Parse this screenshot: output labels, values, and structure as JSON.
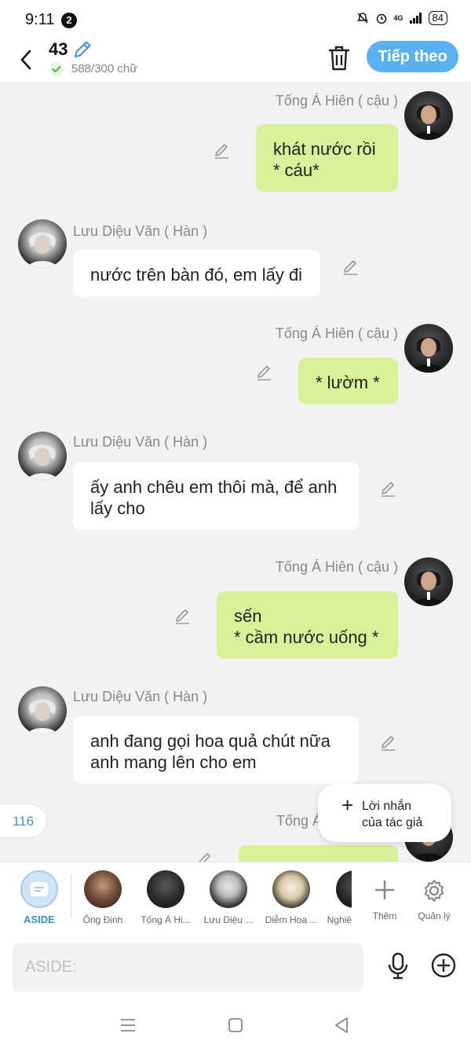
{
  "status_bar": {
    "time": "9:11",
    "notification_count": "2",
    "network": "4G",
    "battery": "84"
  },
  "header": {
    "title_number": "43",
    "word_count": "588/300 chữ",
    "next_label": "Tiếp theo"
  },
  "messages": [
    {
      "side": "right",
      "name": "Tống Á Hiên ( cậu )",
      "text": "khát nước rồi\n* cáu*"
    },
    {
      "side": "left",
      "name": "Lưu Diệu Văn ( Hàn )",
      "text": "nước trên bàn đó, em lấy đi"
    },
    {
      "side": "right",
      "name": "Tống Á Hiên ( cậu )",
      "text": "* lườm *"
    },
    {
      "side": "left",
      "name": "Lưu Diệu Văn ( Hàn )",
      "text": "ấy anh chêu em thôi mà, để anh\nlấy cho"
    },
    {
      "side": "right",
      "name": "Tống Á Hiên ( cậu )",
      "text": "sến\n* cầm nước uống *"
    },
    {
      "side": "left",
      "name": "Lưu Diệu Văn ( Hàn )",
      "text": "anh đang gọi hoa quả chút nữa\nanh mang lên cho em"
    },
    {
      "side": "right",
      "name": "Tống Á",
      "text": ""
    }
  ],
  "counter": "116",
  "author_note": {
    "line1": "Lời nhắn",
    "line2": "của tác giả"
  },
  "characters": [
    {
      "label": "ASIDE"
    },
    {
      "label": "Ông Đinh"
    },
    {
      "label": "Tống Á Hi..."
    },
    {
      "label": "Lưu Diệu ..."
    },
    {
      "label": "Diễm Hoa ..."
    },
    {
      "label": "Nghiê"
    }
  ],
  "actions": {
    "more": "Thêm",
    "manage": "Quản lý"
  },
  "input": {
    "placeholder": "ASIDE:"
  },
  "colors": {
    "accent": "#5bb0ee",
    "bubble_right": "#d8f29a",
    "bubble_left": "#ffffff",
    "background": "#f2f2f2"
  }
}
